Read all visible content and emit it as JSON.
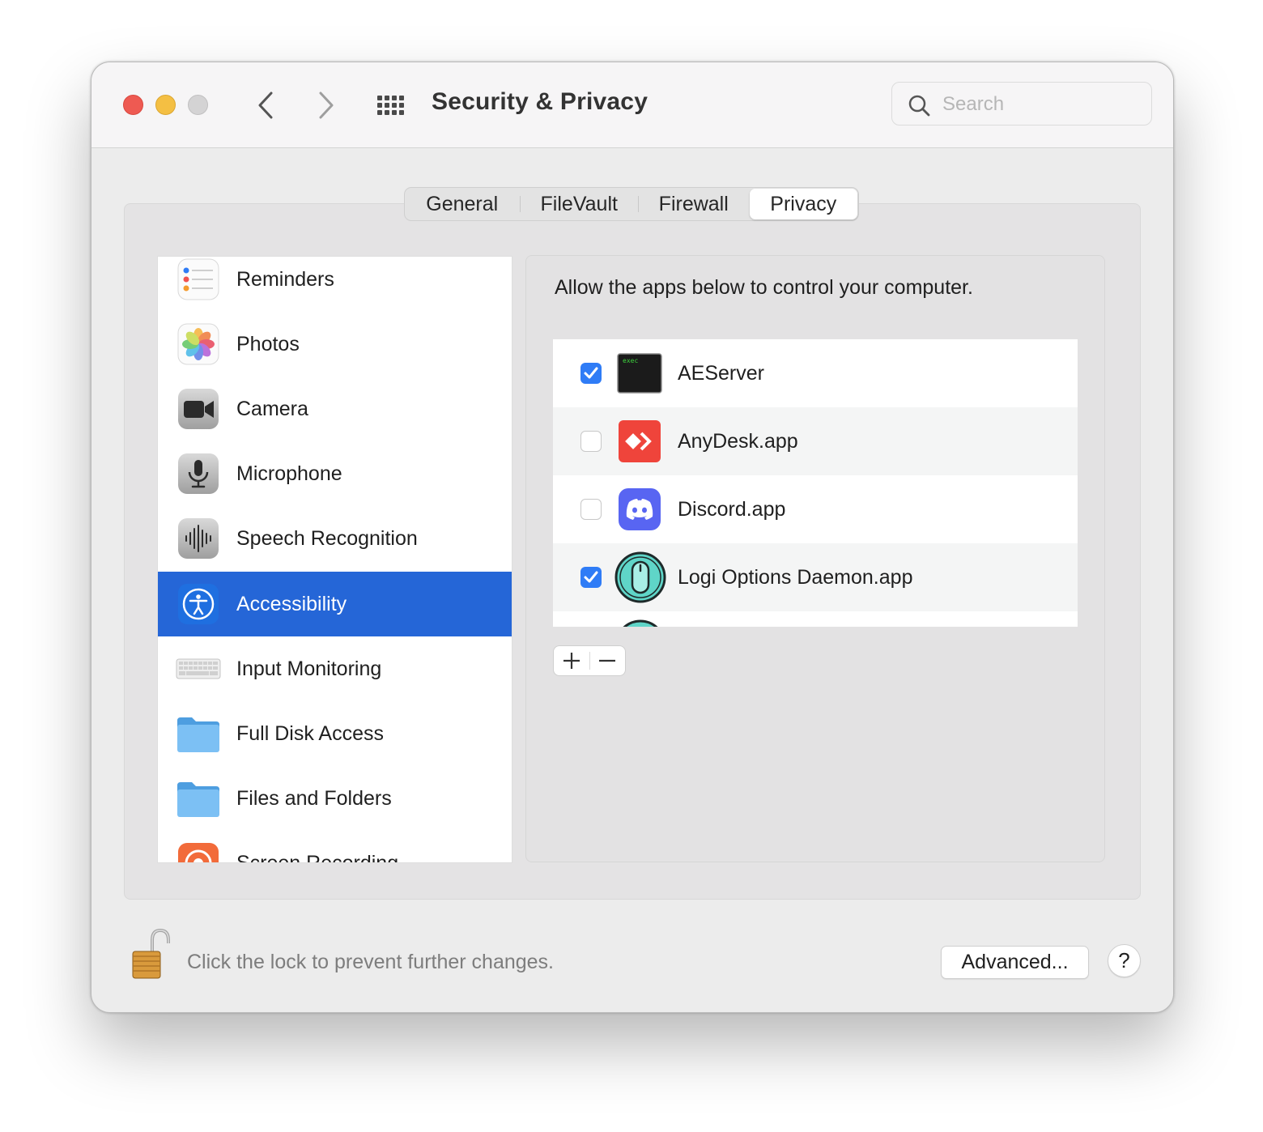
{
  "window": {
    "title": "Security & Privacy",
    "search_placeholder": "Search"
  },
  "tabs": [
    {
      "label": "General",
      "selected": false
    },
    {
      "label": "FileVault",
      "selected": false
    },
    {
      "label": "Firewall",
      "selected": false
    },
    {
      "label": "Privacy",
      "selected": true
    }
  ],
  "sidebar": {
    "items": [
      {
        "label": "Reminders",
        "icon": "reminders-icon"
      },
      {
        "label": "Photos",
        "icon": "photos-icon"
      },
      {
        "label": "Camera",
        "icon": "camera-icon"
      },
      {
        "label": "Microphone",
        "icon": "microphone-icon"
      },
      {
        "label": "Speech Recognition",
        "icon": "speech-recognition-icon"
      },
      {
        "label": "Accessibility",
        "icon": "accessibility-icon",
        "selected": true
      },
      {
        "label": "Input Monitoring",
        "icon": "keyboard-icon"
      },
      {
        "label": "Full Disk Access",
        "icon": "folder-icon"
      },
      {
        "label": "Files and Folders",
        "icon": "folder-icon"
      },
      {
        "label": "Screen Recording",
        "icon": "screen-recording-icon"
      }
    ]
  },
  "main": {
    "heading": "Allow the apps below to control your computer.",
    "apps": [
      {
        "name": "AEServer",
        "checked": true,
        "icon": "terminal-exec-icon",
        "icon_text": "exec"
      },
      {
        "name": "AnyDesk.app",
        "checked": false,
        "icon": "anydesk-icon"
      },
      {
        "name": "Discord.app",
        "checked": false,
        "icon": "discord-icon"
      },
      {
        "name": "Logi Options Daemon.app",
        "checked": true,
        "icon": "logi-mouse-icon"
      }
    ],
    "add_symbol": "+",
    "remove_symbol": "−"
  },
  "footer": {
    "lock_text": "Click the lock to prevent further changes.",
    "advanced_label": "Advanced...",
    "help_label": "?"
  },
  "colors": {
    "selection": "#2566d7",
    "checkbox_on": "#2f7cf6",
    "close": "#ee5a52",
    "minimize": "#f4bf43"
  }
}
